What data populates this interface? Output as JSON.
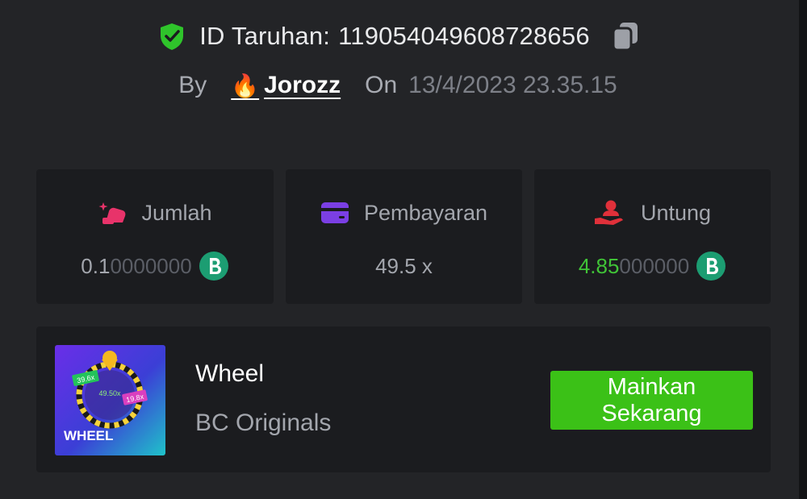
{
  "bet": {
    "id_label": "ID Taruhan:",
    "id_value": "119054049608728656",
    "by_label": "By",
    "username": "Jorozz",
    "on_label": "On",
    "date": "13/4/2023 23.35.15"
  },
  "stats": {
    "amount": {
      "label": "Jumlah",
      "value_main": "0.1",
      "value_faded": "0000000"
    },
    "payout": {
      "label": "Pembayaran",
      "value": "49.5 x"
    },
    "profit": {
      "label": "Untung",
      "value_main": "4.85",
      "value_faded": "000000"
    }
  },
  "game": {
    "title": "Wheel",
    "provider": "BC Originals",
    "play_label": "Mainkan Sekarang",
    "thumb_label": "WHEEL",
    "thumb_multipliers": [
      "39.6x",
      "49.50x",
      "19.8x"
    ]
  },
  "colors": {
    "accent_green": "#3bc117",
    "profit_green": "#40c337",
    "jumlah_icon": "#e8336a",
    "payment_icon": "#7b3fe4",
    "profit_icon": "#e0303a"
  },
  "icons": {
    "verified": "shield-check-icon",
    "copy": "copy-icon",
    "user_badge": "fire-icon",
    "amount": "bet-amount-icon",
    "payout": "card-icon",
    "profit": "hand-user-icon",
    "currency": "bc-coin-icon"
  }
}
